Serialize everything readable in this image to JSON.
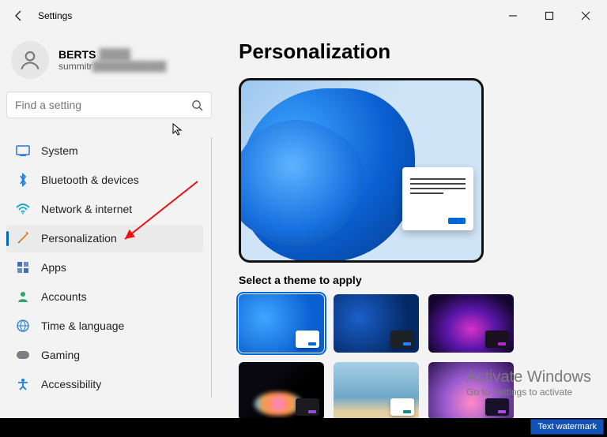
{
  "titlebar": {
    "title": "Settings"
  },
  "account": {
    "name": "BERTS",
    "email": "summitr"
  },
  "search": {
    "placeholder": "Find a setting"
  },
  "nav": {
    "items": [
      {
        "label": "System"
      },
      {
        "label": "Bluetooth & devices"
      },
      {
        "label": "Network & internet"
      },
      {
        "label": "Personalization"
      },
      {
        "label": "Apps"
      },
      {
        "label": "Accounts"
      },
      {
        "label": "Time & language"
      },
      {
        "label": "Gaming"
      },
      {
        "label": "Accessibility"
      }
    ]
  },
  "main": {
    "heading": "Personalization",
    "theme_section_title": "Select a theme to apply"
  },
  "activate": {
    "line1": "Activate Windows",
    "line2": "Go to Settings to activate"
  },
  "watermark": {
    "label": "Text watermark"
  }
}
